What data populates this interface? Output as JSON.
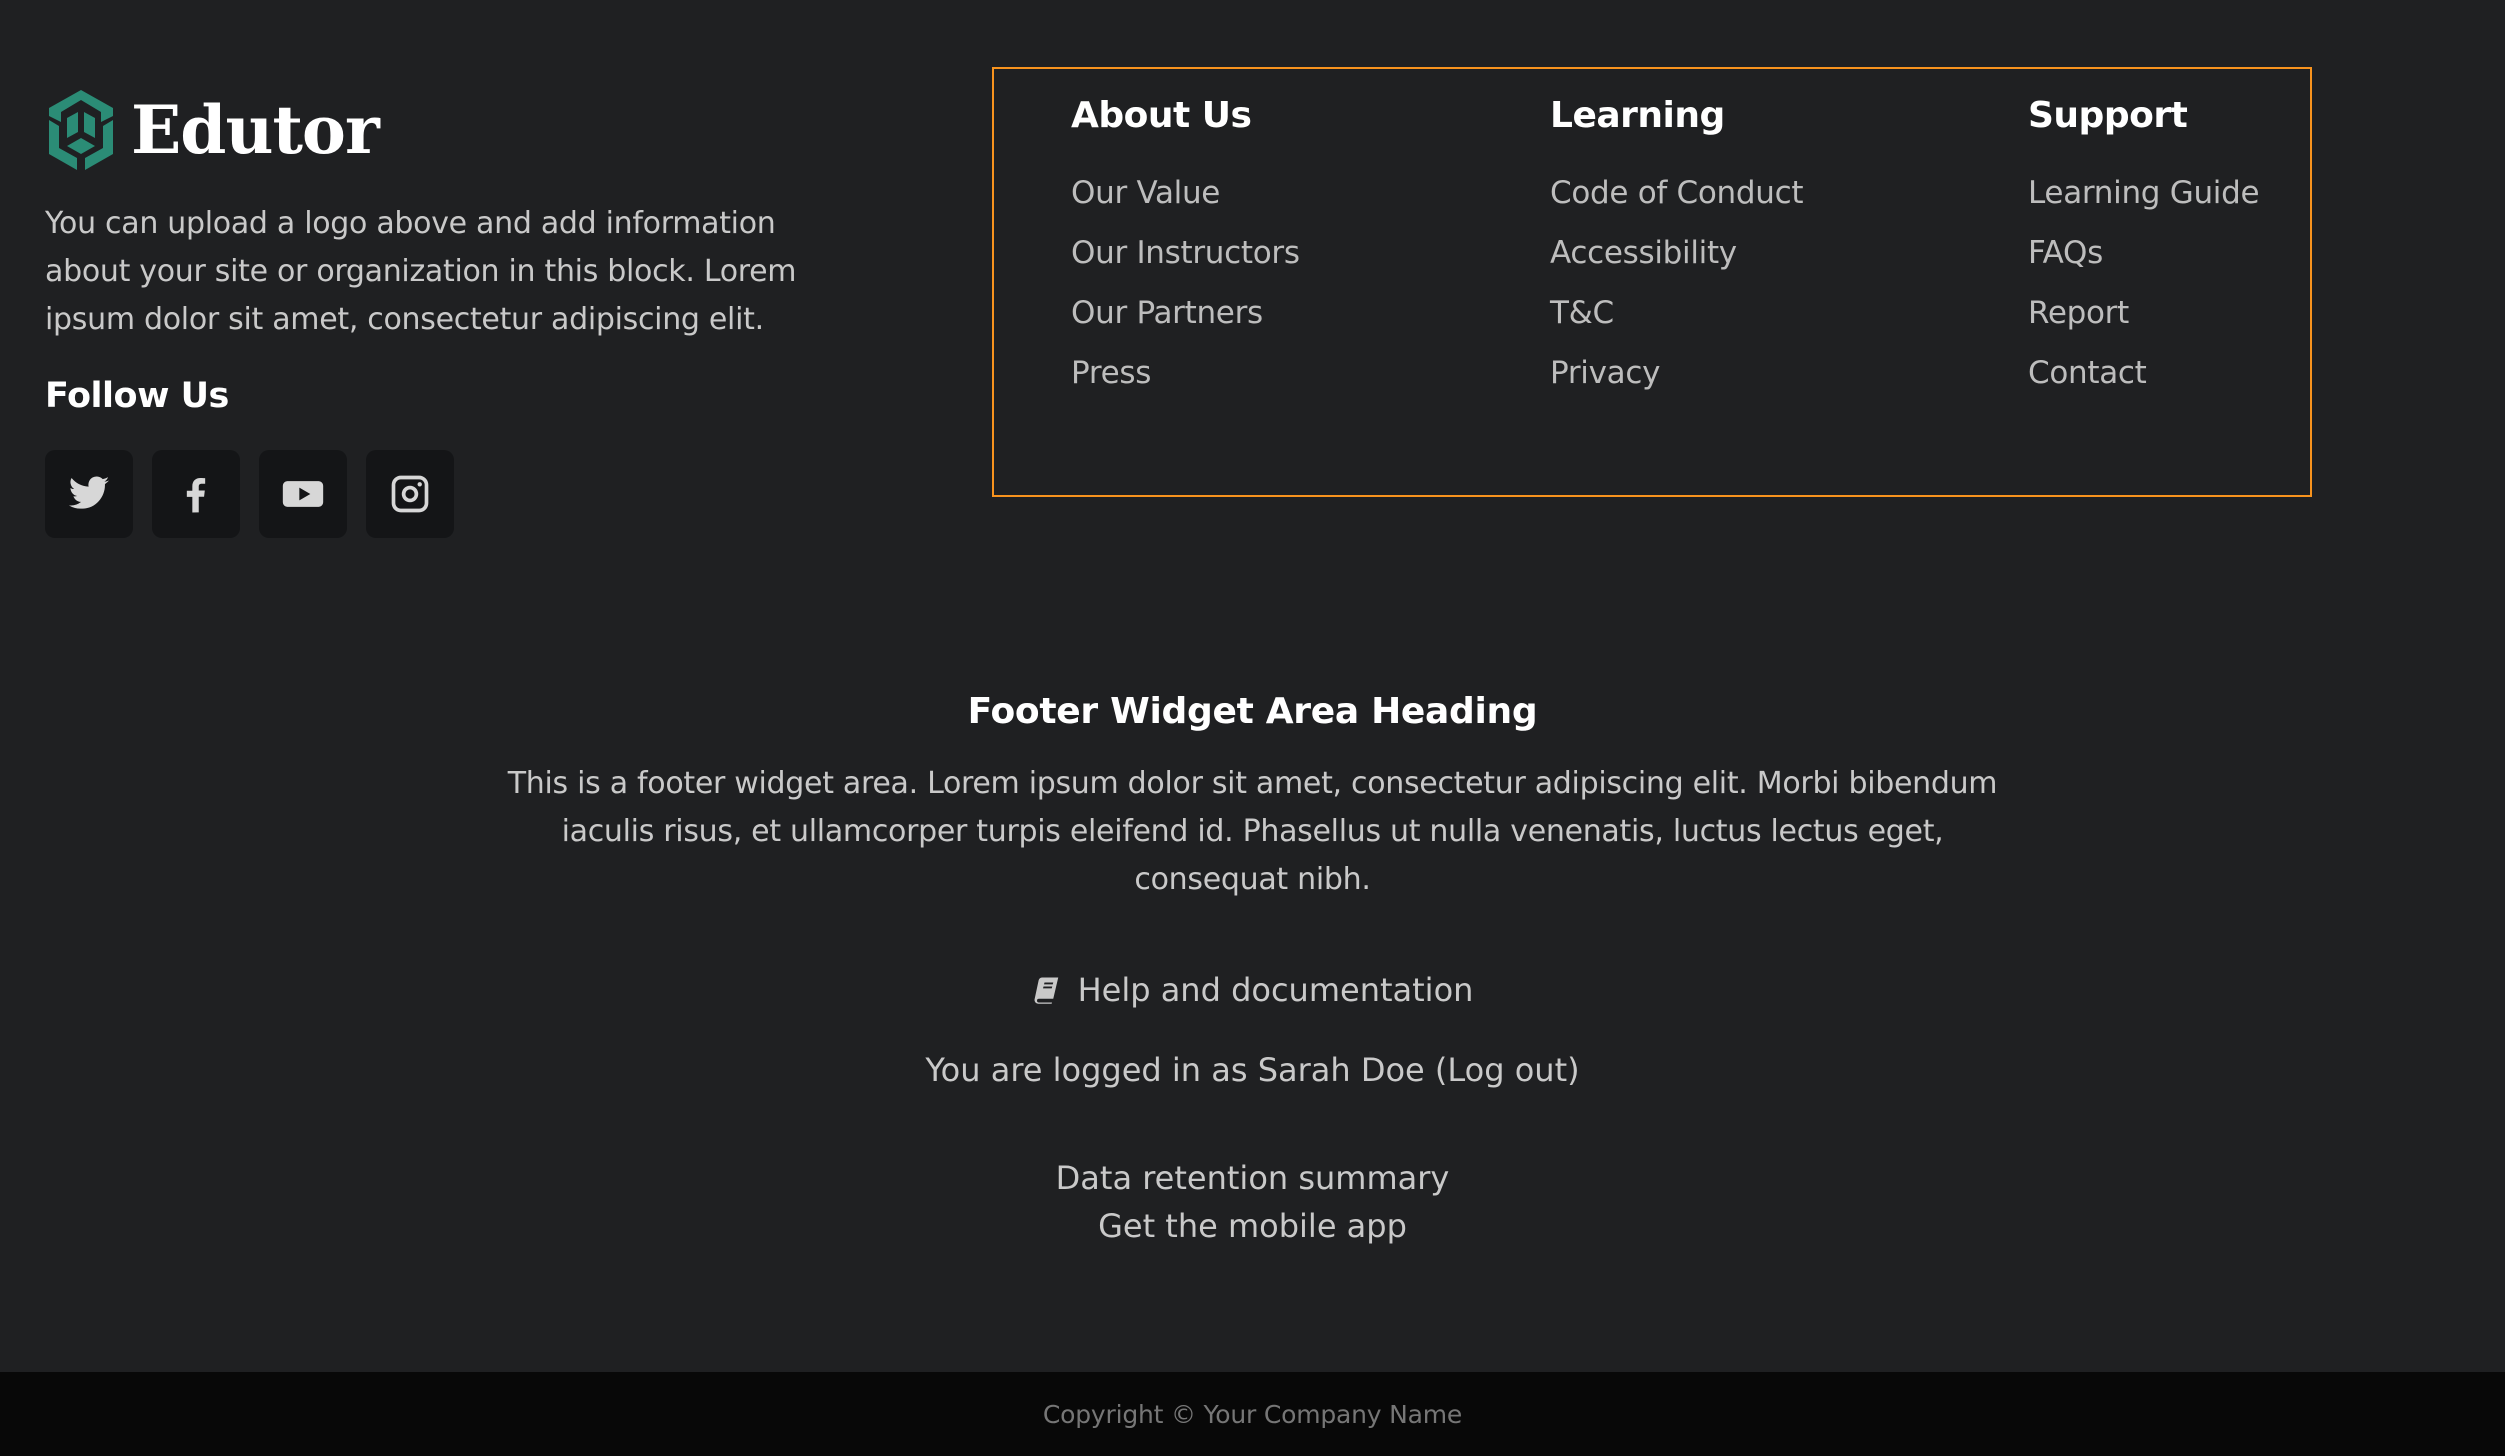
{
  "brand": {
    "name": "Edutor",
    "logo_icon": "hexagon-cube-logo-icon",
    "accent_color": "#2b8c76",
    "description": "You can upload a logo above and add information about your site or organization in this block. Lorem ipsum dolor sit amet, consectetur adipiscing elit."
  },
  "social": {
    "heading": "Follow Us",
    "items": [
      {
        "name": "Twitter",
        "icon": "twitter-icon"
      },
      {
        "name": "Facebook",
        "icon": "facebook-icon"
      },
      {
        "name": "YouTube",
        "icon": "youtube-icon"
      },
      {
        "name": "Instagram",
        "icon": "instagram-icon"
      }
    ]
  },
  "link_box": {
    "border_color": "#f7931e",
    "columns": [
      {
        "heading": "About Us",
        "links": [
          "Our Value",
          "Our Instructors",
          "Our Partners",
          "Press"
        ]
      },
      {
        "heading": "Learning",
        "links": [
          "Code of Conduct",
          "Accessibility",
          "T&C",
          "Privacy"
        ]
      },
      {
        "heading": "Support",
        "links": [
          "Learning Guide",
          "FAQs",
          "Report",
          "Contact"
        ]
      }
    ]
  },
  "widget": {
    "heading": "Footer Widget Area Heading",
    "body": "This is a footer widget area. Lorem ipsum dolor sit amet, consectetur adipiscing elit. Morbi bibendum iaculis risus, et ullamcorper turpis eleifend id. Phasellus ut nulla venenatis, luctus lectus eget, consequat nibh."
  },
  "help": {
    "icon": "book-icon",
    "label": "Help and documentation"
  },
  "login": {
    "prefix": "You are logged in as ",
    "user": "Sarah Doe",
    "logout_label": "(Log out)"
  },
  "extra_links": [
    "Data retention summary",
    "Get the mobile app"
  ],
  "copyright": "Copyright © Your Company Name"
}
